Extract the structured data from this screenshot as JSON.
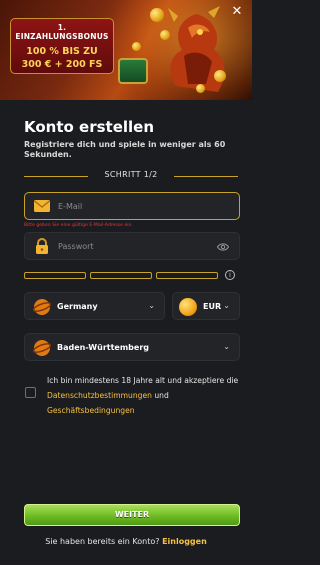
{
  "banner": {
    "bonus_line1": "1. EINZAHLUNGSBONUS",
    "bonus_line2": "100 % BIS ZU",
    "bonus_line3": "300 € + 200 FS",
    "close_glyph": "✕"
  },
  "form": {
    "title": "Konto erstellen",
    "subtitle": "Registriere dich und spiele in weniger als 60 Sekunden.",
    "step_label": "SCHRITT 1/2",
    "email_placeholder": "E-Mail",
    "email_error": "Bitte geben Sie eine gültige E-Mail-Adresse ein.",
    "password_placeholder": "Passwort",
    "info_glyph": "i",
    "country": "Germany",
    "currency": "EUR",
    "region": "Baden-Württemberg",
    "chevron": "⌄",
    "terms_prefix": "Ich bin mindestens 18 Jahre alt und akzeptiere die ",
    "terms_link1": "Datenschutzbestimmungen",
    "terms_and": " und ",
    "terms_link2": "Geschäftsbedingungen",
    "continue_label": "WEITER",
    "login_prompt": "Sie haben bereits ein Konto?",
    "login_link": "Einloggen"
  },
  "colors": {
    "accent_gold": "#c9a22a",
    "link_yellow": "#f5c142",
    "error_red": "#e0383a",
    "button_green": "#6dbb22",
    "background": "#1b1c1f"
  },
  "icons": [
    "close-icon",
    "envelope-icon",
    "lock-icon",
    "eye-icon",
    "info-icon",
    "country-flag-icon",
    "coin-icon",
    "region-flag-icon",
    "chevron-down-icon"
  ]
}
